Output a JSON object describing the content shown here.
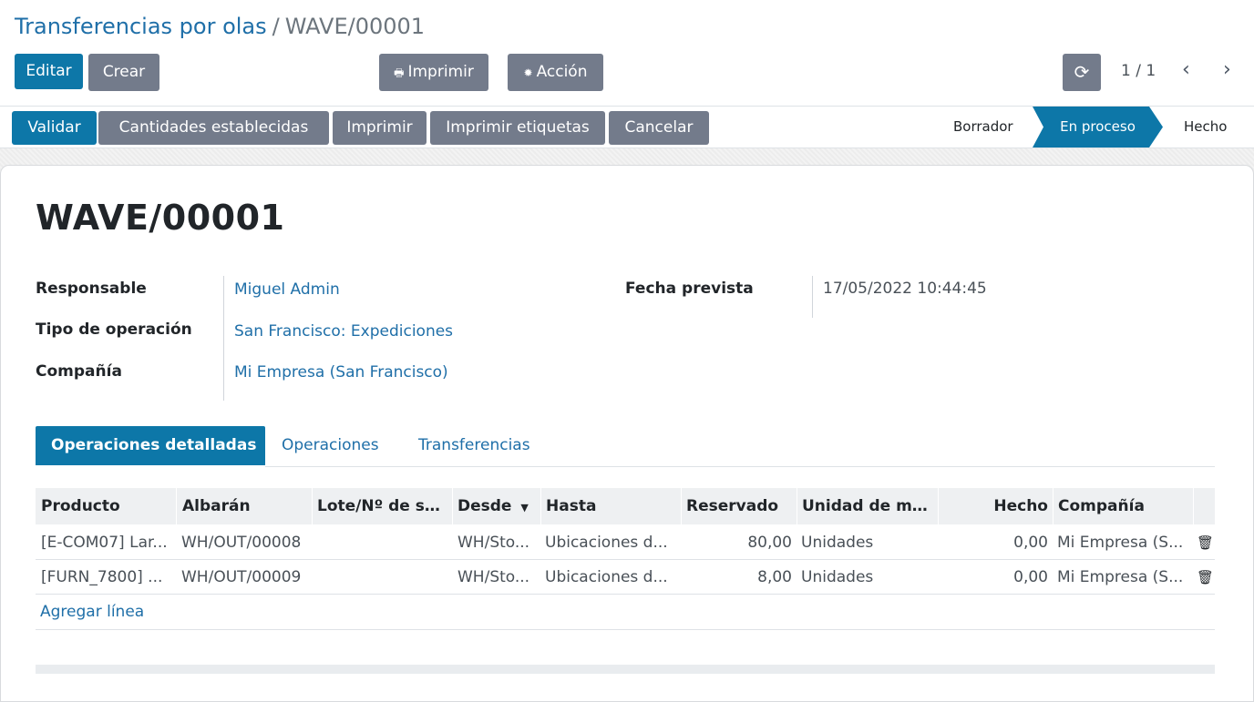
{
  "breadcrumb": {
    "parent": "Transferencias por olas",
    "separator": "/",
    "current": "WAVE/00001"
  },
  "toolbar": {
    "edit": "Editar",
    "create": "Crear",
    "print": "Imprimir",
    "action": "Acción",
    "print_icon": "printer-icon",
    "action_icon": "gear-icon",
    "refresh_icon": "refresh-icon"
  },
  "pager": {
    "value": "1 / 1"
  },
  "statusbar": {
    "buttons": [
      "Validar",
      "Cantidades establecidas",
      "Imprimir",
      "Imprimir etiquetas",
      "Cancelar"
    ],
    "stages": [
      "Borrador",
      "En proceso",
      "Hecho"
    ],
    "active_stage": "En proceso"
  },
  "record": {
    "name": "WAVE/00001",
    "fields": {
      "responsable": {
        "label": "Responsable",
        "value": "Miguel Admin"
      },
      "tipo": {
        "label": "Tipo de operación",
        "value": "San Francisco: Expediciones"
      },
      "compania": {
        "label": "Compañía",
        "value": "Mi Empresa (San Francisco)"
      },
      "fecha": {
        "label": "Fecha prevista",
        "value": "17/05/2022 10:44:45"
      }
    }
  },
  "tabs": [
    "Operaciones detalladas",
    "Operaciones",
    "Transferencias"
  ],
  "table": {
    "columns": [
      "Producto",
      "Albarán",
      "Lote/Nº de ser...",
      "Desde",
      "Hasta",
      "Reservado",
      "Unidad de me...",
      "Hecho",
      "Compañía"
    ],
    "sort_column": "Desde",
    "rows": [
      [
        "[E-COM07] Lar...",
        "WH/OUT/00008",
        "",
        "WH/Sto...",
        "Ubicaciones d...",
        "80,00",
        "Unidades",
        "0,00",
        "Mi Empresa (S..."
      ],
      [
        "[FURN_7800] ...",
        "WH/OUT/00009",
        "",
        "WH/Sto...",
        "Ubicaciones d...",
        "8,00",
        "Unidades",
        "0,00",
        "Mi Empresa (S..."
      ]
    ],
    "add_line": "Agregar línea"
  },
  "colors": {
    "primary": "#0d77a8",
    "secondary": "#737b8b",
    "link": "#1f6fa8"
  }
}
